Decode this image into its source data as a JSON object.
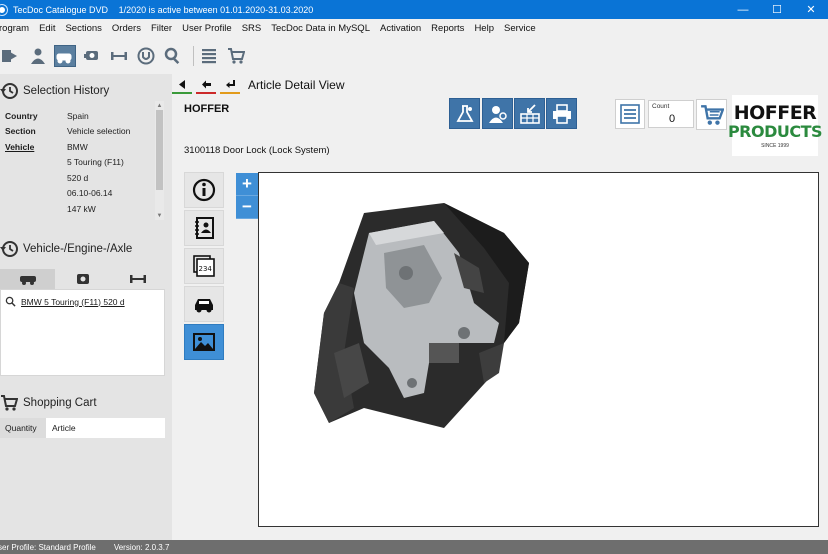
{
  "window": {
    "app_name": "TecDoc Catalogue DVD",
    "title_info": "1/2020 is active between 01.01.2020-31.03.2020",
    "minimize": "—",
    "maximize": "☐",
    "close": "✕"
  },
  "menu": [
    "rogram",
    "Edit",
    "Sections",
    "Orders",
    "Filter",
    "User Profile",
    "SRS",
    "TecDoc Data in MySQL",
    "Activation",
    "Reports",
    "Help",
    "Service"
  ],
  "selection_history": {
    "title": "Selection History",
    "rows": [
      {
        "key": "Country",
        "value": "Spain",
        "link": false
      },
      {
        "key": "Section",
        "value": "Vehicle selection",
        "link": false
      },
      {
        "key": "Vehicle",
        "value": "BMW",
        "link": true
      },
      {
        "key": "",
        "value": "5 Touring (F11)",
        "link": false
      },
      {
        "key": "",
        "value": "520 d",
        "link": false
      },
      {
        "key": "",
        "value": "06.10-06.14",
        "link": false
      },
      {
        "key": "",
        "value": "147 kW",
        "link": false
      }
    ]
  },
  "vehicle_engine_axle": {
    "title": "Vehicle-/Engine-/Axle",
    "items": [
      "BMW 5 Touring (F11) 520 d"
    ]
  },
  "shopping_cart": {
    "title": "Shopping Cart",
    "col_quantity": "Quantity",
    "col_article": "Article"
  },
  "main": {
    "view_title": "Article Detail View",
    "brand": "HOFFER",
    "article_name": "3100118 Door Lock (Lock System)",
    "count_label": "Count",
    "count_value": "0",
    "logo_line1": "HOFFER",
    "logo_line2": "PRODUCTS",
    "logo_line3": "SINCE 1999",
    "zoom_in": "+",
    "zoom_out": "−"
  },
  "status": {
    "profile": "ser Profile: Standard Profile",
    "version": "Version: 2.0.3.7"
  },
  "colors": {
    "titlebar": "#0a74d6",
    "accent_blue": "#3f8fd6",
    "action_blue": "#3f74a8",
    "logo_green": "#2b8a3e",
    "status_gray": "#6e6e6e"
  }
}
